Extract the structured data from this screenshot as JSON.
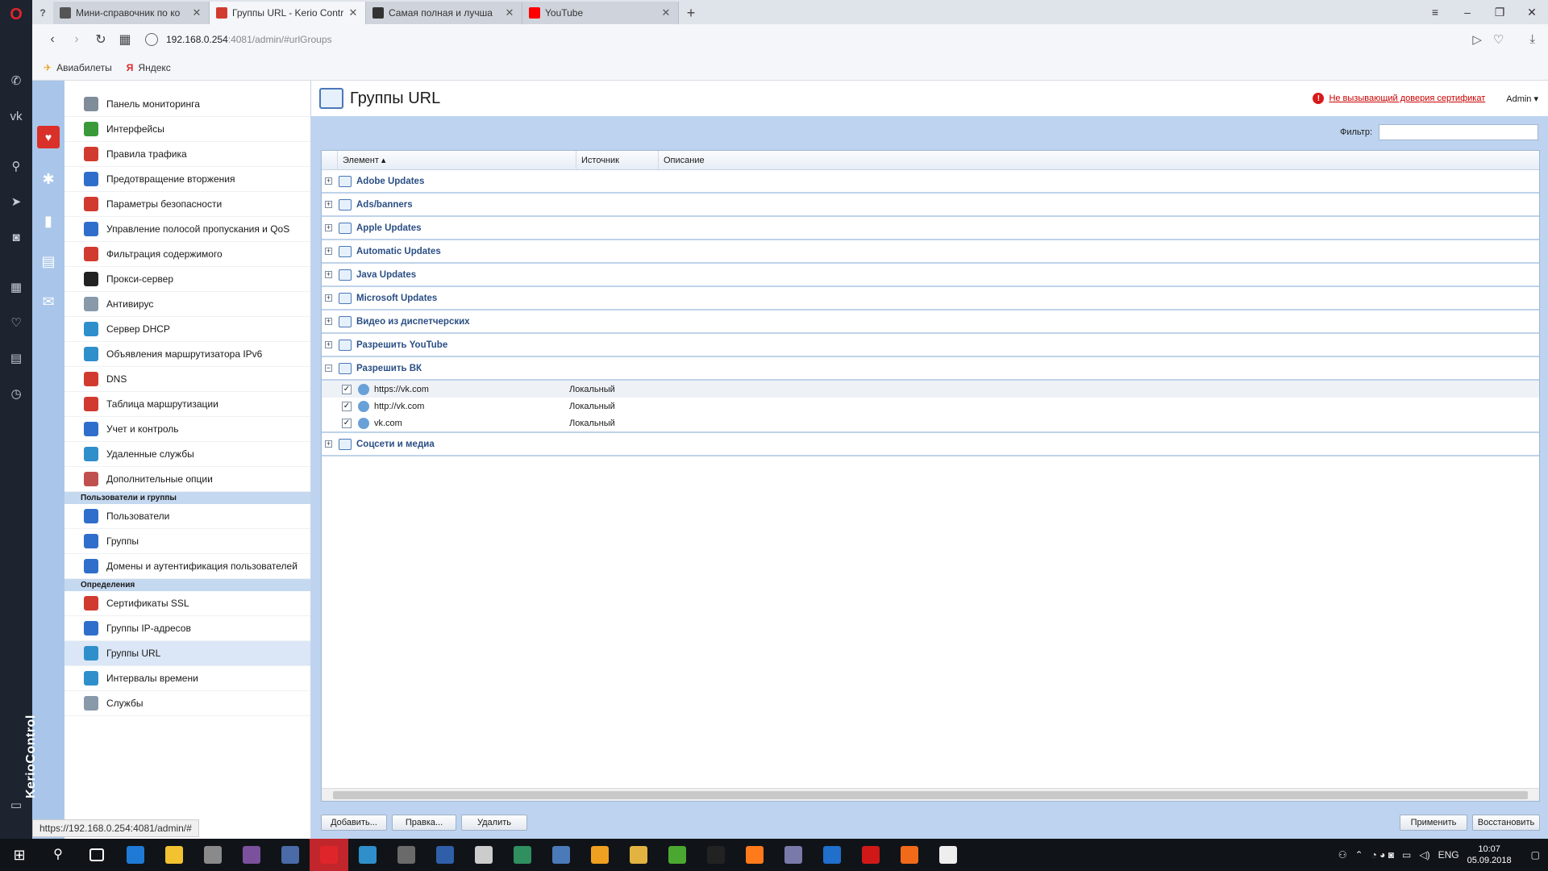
{
  "browser": {
    "tabs": [
      {
        "title": "Мини-справочник по ко",
        "active": false,
        "favicon_color": "#555555"
      },
      {
        "title": "Группы URL - Kerio Contr",
        "active": true,
        "favicon_color": "#d13b2f"
      },
      {
        "title": "Самая полная и лучша",
        "active": false,
        "favicon_color": "#333333"
      },
      {
        "title": "YouTube",
        "active": false,
        "favicon_color": "#ff0000"
      }
    ],
    "address": {
      "host": "192.168.0.254",
      "path": ":4081/admin/#urlGroups"
    },
    "bookmarks": [
      {
        "label": "Авиабилеты",
        "icon": "plane-icon"
      },
      {
        "label": "Яндекс",
        "icon": "yandex-icon"
      }
    ],
    "status_url": "https://192.168.0.254:4081/admin/#"
  },
  "kerio": {
    "brand": "KerioControl",
    "nav_items": [
      {
        "label": "Панель мониторинга",
        "color": "#7f8c9a"
      },
      {
        "label": "Интерфейсы",
        "color": "#3a9a3a"
      },
      {
        "label": "Правила трафика",
        "color": "#d13b2f"
      },
      {
        "label": "Предотвращение вторжения",
        "color": "#2f6fcb"
      },
      {
        "label": "Параметры безопасности",
        "color": "#d13b2f"
      },
      {
        "label": "Управление полосой пропускания и QoS",
        "color": "#2f6fcb"
      },
      {
        "label": "Фильтрация содержимого",
        "color": "#d13b2f"
      },
      {
        "label": "Прокси-сервер",
        "color": "#222222"
      },
      {
        "label": "Антивирус",
        "color": "#8899aa"
      },
      {
        "label": "Сервер DHCP",
        "color": "#2f8fcb"
      },
      {
        "label": "Объявления маршрутизатора IPv6",
        "color": "#2f8fcb"
      },
      {
        "label": "DNS",
        "color": "#d13b2f"
      },
      {
        "label": "Таблица маршрутизации",
        "color": "#d13b2f"
      },
      {
        "label": "Учет и контроль",
        "color": "#2f6fcb"
      },
      {
        "label": "Удаленные службы",
        "color": "#2f8fcb"
      },
      {
        "label": "Дополнительные опции",
        "color": "#c0504d"
      }
    ],
    "section_users": "Пользователи и группы",
    "users_items": [
      {
        "label": "Пользователи",
        "color": "#2f6fcb"
      },
      {
        "label": "Группы",
        "color": "#2f6fcb"
      },
      {
        "label": "Домены и аутентификация пользователей",
        "color": "#2f6fcb"
      }
    ],
    "section_defs": "Определения",
    "defs_items": [
      {
        "label": "Сертификаты SSL",
        "color": "#d13b2f"
      },
      {
        "label": "Группы IP-адресов",
        "color": "#2f6fcb"
      },
      {
        "label": "Группы URL",
        "color": "#2f8fcb",
        "selected": true
      },
      {
        "label": "Интервалы времени",
        "color": "#2f8fcb"
      },
      {
        "label": "Службы",
        "color": "#8899aa"
      }
    ],
    "page_title": "Группы URL",
    "cert_warning": "Не вызывающий доверия сертификат",
    "admin_menu": "Admin ▾",
    "filter_label": "Фильтр:",
    "filter_value": "",
    "columns": {
      "element": "Элемент ▴",
      "source": "Источник",
      "description": "Описание"
    },
    "groups": [
      {
        "name": "Adobe Updates",
        "expanded": false,
        "children": []
      },
      {
        "name": "Ads/banners",
        "expanded": false,
        "children": []
      },
      {
        "name": "Apple Updates",
        "expanded": false,
        "children": []
      },
      {
        "name": "Automatic Updates",
        "expanded": false,
        "children": []
      },
      {
        "name": "Java Updates",
        "expanded": false,
        "children": []
      },
      {
        "name": "Microsoft Updates",
        "expanded": false,
        "children": []
      },
      {
        "name": "Видео из диспетчерских",
        "expanded": false,
        "children": []
      },
      {
        "name": "Разрешить YouTube",
        "expanded": false,
        "children": []
      },
      {
        "name": "Разрешить ВК",
        "expanded": true,
        "children": [
          {
            "name": "https://vk.com",
            "source": "Локальный",
            "checked": true
          },
          {
            "name": "http://vk.com",
            "source": "Локальный",
            "checked": true
          },
          {
            "name": "vk.com",
            "source": "Локальный",
            "checked": true
          }
        ]
      },
      {
        "name": "Соцсети и медиа",
        "expanded": false,
        "children": []
      }
    ],
    "buttons": {
      "add": "Добавить...",
      "edit": "Правка...",
      "delete": "Удалить",
      "apply": "Применить",
      "restore": "Восстановить"
    }
  },
  "taskbar": {
    "apps": [
      {
        "name": "search",
        "color": "#101418"
      },
      {
        "name": "task-view",
        "color": "#101418"
      },
      {
        "name": "edge",
        "color": "#1f7ad6"
      },
      {
        "name": "explorer",
        "color": "#f2c230"
      },
      {
        "name": "app",
        "color": "#8a8a8a"
      },
      {
        "name": "viber",
        "color": "#7b519d"
      },
      {
        "name": "app",
        "color": "#4a6aa8"
      },
      {
        "name": "opera",
        "color": "#e0252a",
        "active": true
      },
      {
        "name": "app",
        "color": "#2f8fcb"
      },
      {
        "name": "app",
        "color": "#6a6a6a"
      },
      {
        "name": "powershell",
        "color": "#2f5fa8"
      },
      {
        "name": "app",
        "color": "#cccccc"
      },
      {
        "name": "app",
        "color": "#2f8f5f"
      },
      {
        "name": "app",
        "color": "#4a7ab8"
      },
      {
        "name": "app",
        "color": "#f0a020"
      },
      {
        "name": "app",
        "color": "#e2b341"
      },
      {
        "name": "app",
        "color": "#4aa830"
      },
      {
        "name": "app",
        "color": "#222222"
      },
      {
        "name": "firefox",
        "color": "#ff7a1a"
      },
      {
        "name": "app",
        "color": "#7a7aaa"
      },
      {
        "name": "outlook",
        "color": "#1f6fcb"
      },
      {
        "name": "app",
        "color": "#d01818"
      },
      {
        "name": "app",
        "color": "#f06a1a"
      },
      {
        "name": "mail",
        "color": "#eeeeee"
      }
    ],
    "lang": "ENG",
    "time": "10:07",
    "date": "05.09.2018"
  }
}
